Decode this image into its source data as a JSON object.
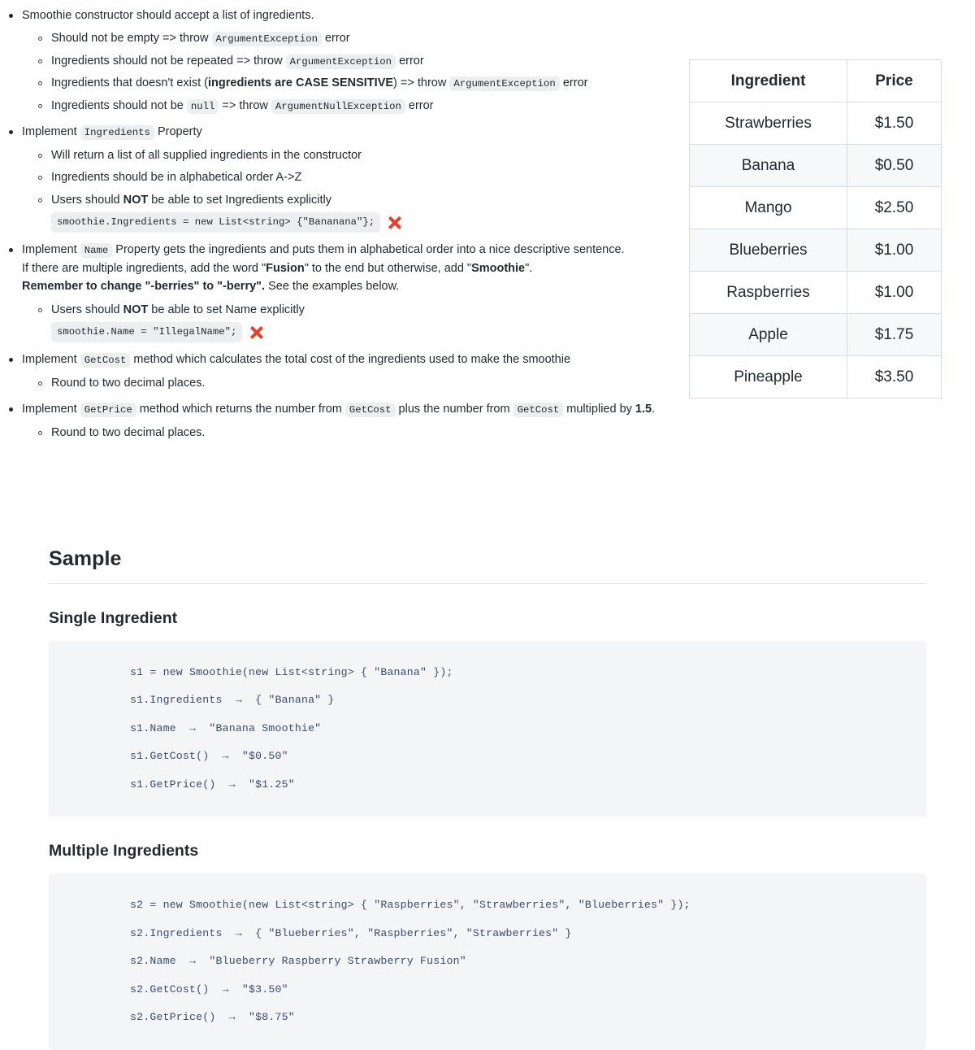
{
  "spec": {
    "items": [
      {
        "id": "constructor",
        "parts": [
          {
            "t": "text",
            "v": "Smoothie constructor should accept a list of ingredients."
          }
        ],
        "sub": [
          {
            "parts": [
              {
                "t": "text",
                "v": "Should not be empty => throw "
              },
              {
                "t": "code",
                "v": "ArgumentException"
              },
              {
                "t": "text",
                "v": " error"
              }
            ]
          },
          {
            "parts": [
              {
                "t": "text",
                "v": "Ingredients should not be repeated => throw "
              },
              {
                "t": "code",
                "v": "ArgumentException"
              },
              {
                "t": "text",
                "v": " error"
              }
            ]
          },
          {
            "parts": [
              {
                "t": "text",
                "v": "Ingredients that doesn't exist ("
              },
              {
                "t": "bold",
                "v": "ingredients are CASE SENSITIVE"
              },
              {
                "t": "text",
                "v": ") => throw "
              },
              {
                "t": "code",
                "v": "ArgumentException"
              },
              {
                "t": "text",
                "v": " error"
              }
            ]
          },
          {
            "parts": [
              {
                "t": "text",
                "v": "Ingredients should not be "
              },
              {
                "t": "code",
                "v": "null"
              },
              {
                "t": "text",
                "v": " => throw "
              },
              {
                "t": "code",
                "v": "ArgumentNullException"
              },
              {
                "t": "text",
                "v": " error"
              }
            ]
          }
        ]
      },
      {
        "id": "ingredients-property",
        "parts": [
          {
            "t": "text",
            "v": "Implement "
          },
          {
            "t": "code",
            "v": "Ingredients"
          },
          {
            "t": "text",
            "v": " Property"
          }
        ],
        "sub": [
          {
            "parts": [
              {
                "t": "text",
                "v": "Will return a list of all supplied ingredients in the constructor"
              }
            ]
          },
          {
            "parts": [
              {
                "t": "text",
                "v": "Ingredients should be in alphabetical order A->Z"
              }
            ]
          },
          {
            "parts": [
              {
                "t": "text",
                "v": "Users should "
              },
              {
                "t": "bold",
                "v": "NOT"
              },
              {
                "t": "text",
                "v": " be able to set Ingredients explicitly"
              }
            ],
            "illegal": "smoothie.Ingredients = new List<string> {\"Bananana\"};"
          }
        ]
      },
      {
        "id": "name-property",
        "parts": [
          {
            "t": "text",
            "v": "Implement "
          },
          {
            "t": "code",
            "v": "Name"
          },
          {
            "t": "text",
            "v": " Property gets the ingredients and puts them in alphabetical order into a nice descriptive sentence."
          },
          {
            "t": "br"
          },
          {
            "t": "text",
            "v": "If there are multiple ingredients, add the word \""
          },
          {
            "t": "bold",
            "v": "Fusion"
          },
          {
            "t": "text",
            "v": "\" to the end but otherwise, add \""
          },
          {
            "t": "bold",
            "v": "Smoothie"
          },
          {
            "t": "text",
            "v": "\"."
          },
          {
            "t": "br"
          },
          {
            "t": "bold",
            "v": "Remember to change \"-berries\" to \"-berry\"."
          },
          {
            "t": "text",
            "v": " See the examples below."
          }
        ],
        "sub": [
          {
            "parts": [
              {
                "t": "text",
                "v": "Users should "
              },
              {
                "t": "bold",
                "v": "NOT"
              },
              {
                "t": "text",
                "v": " be able to set Name explicitly"
              }
            ],
            "illegal": "smoothie.Name = \"IllegalName\";"
          }
        ]
      },
      {
        "id": "getcost-method",
        "parts": [
          {
            "t": "text",
            "v": "Implement "
          },
          {
            "t": "code",
            "v": "GetCost"
          },
          {
            "t": "text",
            "v": " method which calculates the total cost of the ingredients used to make the smoothie"
          }
        ],
        "sub": [
          {
            "parts": [
              {
                "t": "text",
                "v": "Round to two decimal places."
              }
            ]
          }
        ]
      },
      {
        "id": "getprice-method",
        "parts": [
          {
            "t": "text",
            "v": "Implement "
          },
          {
            "t": "code",
            "v": "GetPrice"
          },
          {
            "t": "text",
            "v": " method which returns the number from "
          },
          {
            "t": "code",
            "v": "GetCost"
          },
          {
            "t": "text",
            "v": " plus the number from "
          },
          {
            "t": "code",
            "v": "GetCost"
          },
          {
            "t": "text",
            "v": " multiplied by "
          },
          {
            "t": "bold",
            "v": "1.5"
          },
          {
            "t": "text",
            "v": "."
          }
        ],
        "sub": [
          {
            "parts": [
              {
                "t": "text",
                "v": "Round to two decimal places."
              }
            ]
          }
        ]
      }
    ]
  },
  "price_table": {
    "headers": [
      "Ingredient",
      "Price"
    ],
    "rows": [
      {
        "ingredient": "Strawberries",
        "price": "$1.50"
      },
      {
        "ingredient": "Banana",
        "price": "$0.50"
      },
      {
        "ingredient": "Mango",
        "price": "$2.50"
      },
      {
        "ingredient": "Blueberries",
        "price": "$1.00"
      },
      {
        "ingredient": "Raspberries",
        "price": "$1.00"
      },
      {
        "ingredient": "Apple",
        "price": "$1.75"
      },
      {
        "ingredient": "Pineapple",
        "price": "$3.50"
      }
    ]
  },
  "sample": {
    "title": "Sample",
    "sections": [
      {
        "heading": "Single Ingredient",
        "lines": [
          "s1 = new Smoothie(new List<string> { \"Banana\" });",
          "s1.Ingredients  →  { \"Banana\" }",
          "s1.Name  →  \"Banana Smoothie\"",
          "s1.GetCost()  →  \"$0.50\"",
          "s1.GetPrice()  →  \"$1.25\""
        ]
      },
      {
        "heading": "Multiple Ingredients",
        "lines": [
          "s2 = new Smoothie(new List<string> { \"Raspberries\", \"Strawberries\", \"Blueberries\" });",
          "s2.Ingredients  →  { \"Blueberries\", \"Raspberries\", \"Strawberries\" }",
          "s2.Name  →  \"Blueberry Raspberry Strawberry Fusion\"",
          "s2.GetCost()  →  \"$3.50\"",
          "s2.GetPrice()  →  \"$8.75\""
        ]
      }
    ]
  },
  "colors": {
    "text": "#24292f",
    "code_chip_bg": "#eceef0",
    "code_block_bg": "#f4f5f7",
    "code_text": "#3b4a6b",
    "table_border": "#d8dde3",
    "table_stripe": "#f6f8fa",
    "xmark": "#e8402a"
  }
}
